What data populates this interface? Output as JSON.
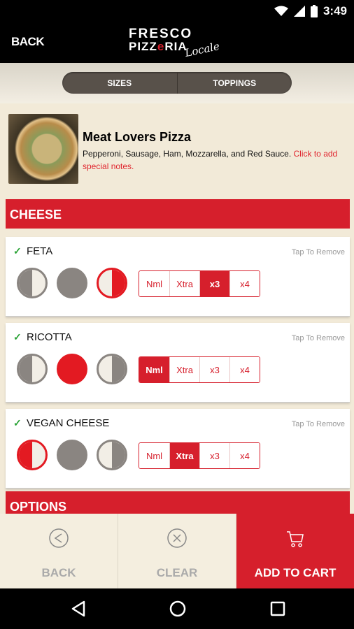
{
  "status_bar": {
    "time": "3:49"
  },
  "header": {
    "back_label": "BACK",
    "logo_line1": "FRESCO",
    "logo_line2a": "PIZZ",
    "logo_line2b": "e",
    "logo_line2c": "RIA",
    "logo_script": "Locale"
  },
  "tabs": [
    "SIZES",
    "TOPPINGS"
  ],
  "product": {
    "name": "Meat Lovers Pizza",
    "description": "Pepperoni, Sausage, Ham, Mozzarella, and Red Sauce.",
    "notes_link": "Click to add special notes."
  },
  "sections": {
    "cheese": "CHEESE",
    "options": "OPTIONS"
  },
  "toppings": [
    {
      "name": "FETA",
      "remove_hint": "Tap To Remove",
      "placement": "right",
      "amounts": [
        "Nml",
        "Xtra",
        "x3",
        "x4"
      ],
      "selected_amount": "x3"
    },
    {
      "name": "RICOTTA",
      "remove_hint": "Tap To Remove",
      "placement": "whole",
      "amounts": [
        "Nml",
        "Xtra",
        "x3",
        "x4"
      ],
      "selected_amount": "Nml"
    },
    {
      "name": "VEGAN CHEESE",
      "remove_hint": "Tap To Remove",
      "placement": "left",
      "amounts": [
        "Nml",
        "Xtra",
        "x3",
        "x4"
      ],
      "selected_amount": "Xtra"
    }
  ],
  "actions": {
    "back": "BACK",
    "clear": "CLEAR",
    "add_to_cart": "ADD TO CART"
  },
  "colors": {
    "brand_red": "#d61f2c",
    "check_green": "#2aa336",
    "background": "#f2ead8"
  }
}
